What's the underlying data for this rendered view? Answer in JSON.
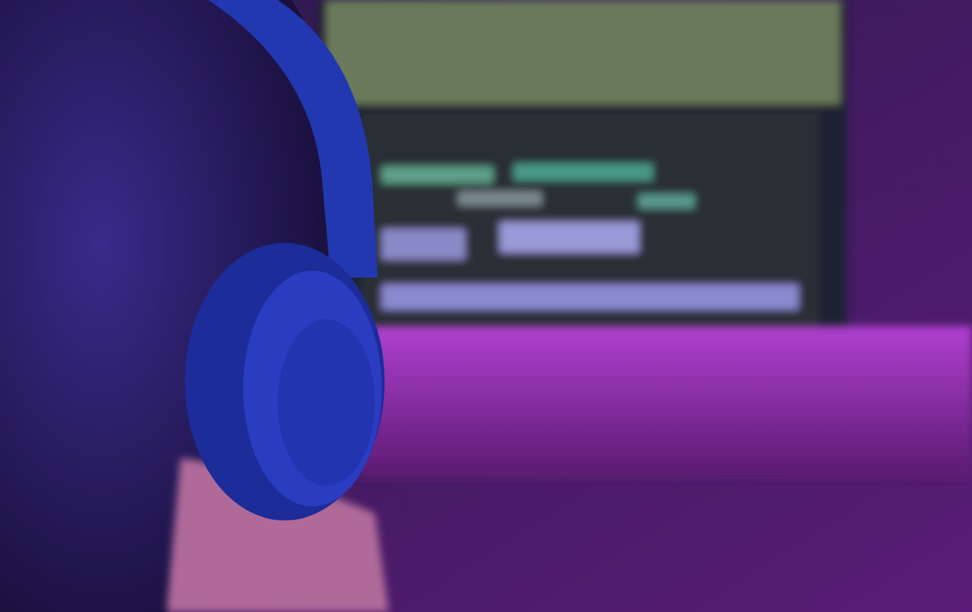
{
  "photo": {
    "kind": "scene"
  }
}
